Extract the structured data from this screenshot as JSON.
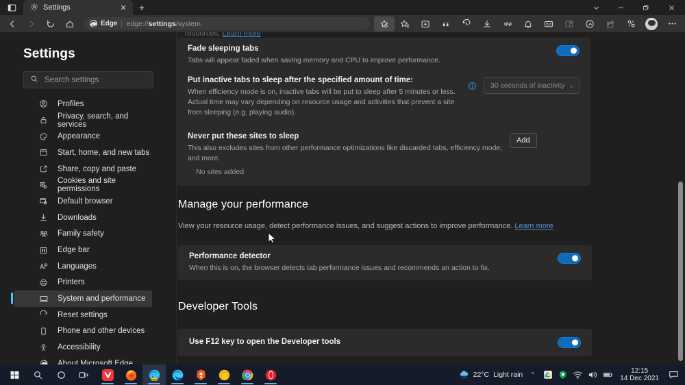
{
  "window": {
    "tab_title": "Settings",
    "new_tab_label": "+",
    "close_tab_label": "✕",
    "controls": {
      "tab_dropdown": "Tab actions",
      "minimize": "Minimize",
      "maximize": "Maximize",
      "close": "Close"
    }
  },
  "toolbar": {
    "back": "Back",
    "forward": "Forward",
    "refresh": "Refresh",
    "home": "Home",
    "omnibox": {
      "badge": "Edge",
      "url_prefix": "edge://",
      "url_bold": "settings",
      "url_suffix": "/system"
    },
    "right_icons": [
      "favorite-star-icon",
      "favorites-list-icon",
      "collections-icon",
      "quote-citations-icon",
      "history-icon",
      "downloads-icon",
      "shopping-icon",
      "notifications-icon",
      "immersive-reader-icon",
      "split-screen-icon",
      "copilot-icon",
      "share-icon",
      "browser-essentials-icon"
    ],
    "settings_more": "Settings and more"
  },
  "sidebar": {
    "title": "Settings",
    "search": {
      "placeholder": "Search settings",
      "value": "",
      "icon": "search-icon"
    },
    "items": [
      {
        "label": "Profiles",
        "icon": "profile-icon",
        "selected": false
      },
      {
        "label": "Privacy, search, and services",
        "icon": "lock-icon",
        "selected": false
      },
      {
        "label": "Appearance",
        "icon": "appearance-icon",
        "selected": false
      },
      {
        "label": "Start, home, and new tabs",
        "icon": "home-page-icon",
        "selected": false
      },
      {
        "label": "Share, copy and paste",
        "icon": "share-icon",
        "selected": false
      },
      {
        "label": "Cookies and site permissions",
        "icon": "cookie-icon",
        "selected": false
      },
      {
        "label": "Default browser",
        "icon": "default-browser-icon",
        "selected": false
      },
      {
        "label": "Downloads",
        "icon": "download-icon",
        "selected": false
      },
      {
        "label": "Family safety",
        "icon": "family-icon",
        "selected": false
      },
      {
        "label": "Edge bar",
        "icon": "edge-bar-icon",
        "selected": false
      },
      {
        "label": "Languages",
        "icon": "languages-icon",
        "selected": false
      },
      {
        "label": "Printers",
        "icon": "printer-icon",
        "selected": false
      },
      {
        "label": "System and performance",
        "icon": "system-icon",
        "selected": true
      },
      {
        "label": "Reset settings",
        "icon": "reset-icon",
        "selected": false
      },
      {
        "label": "Phone and other devices",
        "icon": "phone-icon",
        "selected": false
      },
      {
        "label": "Accessibility",
        "icon": "accessibility-icon",
        "selected": false
      },
      {
        "label": "About Microsoft Edge",
        "icon": "edge-logo-icon",
        "selected": false
      }
    ]
  },
  "content": {
    "clipped_top": {
      "text": "resources.",
      "link": "Learn more"
    },
    "sleeping_tabs_card": {
      "fade_sleeping_tabs": {
        "title": "Fade sleeping tabs",
        "desc": "Tabs will appear faded when saving memory and CPU to improve performance.",
        "toggle_on": true
      },
      "inactive_timeout": {
        "title": "Put inactive tabs to sleep after the specified amount of time:",
        "desc": "When efficiency mode is on, inactive tabs will be put to sleep after 5 minutes or less. Actual time may vary depending on resource usage and activities that prevent a site from sleeping (e.g. playing audio).",
        "info_icon": "info-icon",
        "select_value": "30 seconds of inactivity",
        "select_disabled": true,
        "chevron": "⌄"
      },
      "never_sleep_sites": {
        "title": "Never put these sites to sleep",
        "desc": "This also excludes sites from other performance optimizations like discarded tabs, efficiency mode, and more.",
        "add_button": "Add",
        "empty_text": "No sites added"
      }
    },
    "manage_performance": {
      "heading": "Manage your performance",
      "desc": "View your resource usage, detect performance issues, and suggest actions to improve performance.",
      "link": "Learn more",
      "performance_detector": {
        "title": "Performance detector",
        "desc": "When this is on, the browser detects tab performance issues and recommends an action to fix.",
        "toggle_on": true
      }
    },
    "developer_tools": {
      "heading": "Developer Tools",
      "f12_key": {
        "title": "Use F12 key to open the Developer tools",
        "toggle_on": true
      }
    }
  },
  "taskbar": {
    "start": "start-icon",
    "search": "search-icon",
    "cortana": "cortana-icon",
    "task_view": "task-view-icon",
    "apps": [
      {
        "name": "vivaldi-taskbar-icon",
        "running": true
      },
      {
        "name": "firefox-taskbar-icon",
        "running": true
      },
      {
        "name": "edge-canary-taskbar-icon",
        "running": true,
        "active": true
      },
      {
        "name": "edge-taskbar-icon",
        "running": true
      },
      {
        "name": "brave-taskbar-icon",
        "running": true
      },
      {
        "name": "opera-gx-taskbar-icon",
        "running": true
      },
      {
        "name": "chrome-taskbar-icon",
        "running": true
      },
      {
        "name": "opera-taskbar-icon",
        "running": true
      }
    ],
    "tray": {
      "weather_temp": "22°C",
      "weather_desc": "Light rain",
      "weather_icon": "rain-cloud-icon",
      "overflow_chevron": "⌃",
      "icons": [
        "drive-icon",
        "shield-icon",
        "wifi-icon",
        "volume-icon",
        "battery-icon"
      ],
      "time": "12:15",
      "date": "14 Dec 2021",
      "action_center": "notification-icon"
    }
  },
  "colors": {
    "accent": "#0f6cbd",
    "selected_indicator": "#4cc2ff",
    "link": "#5b8fd1",
    "card_bg": "#2b2b2b",
    "page_bg": "#1f1f1f",
    "taskbar_bg": "#151b28"
  }
}
